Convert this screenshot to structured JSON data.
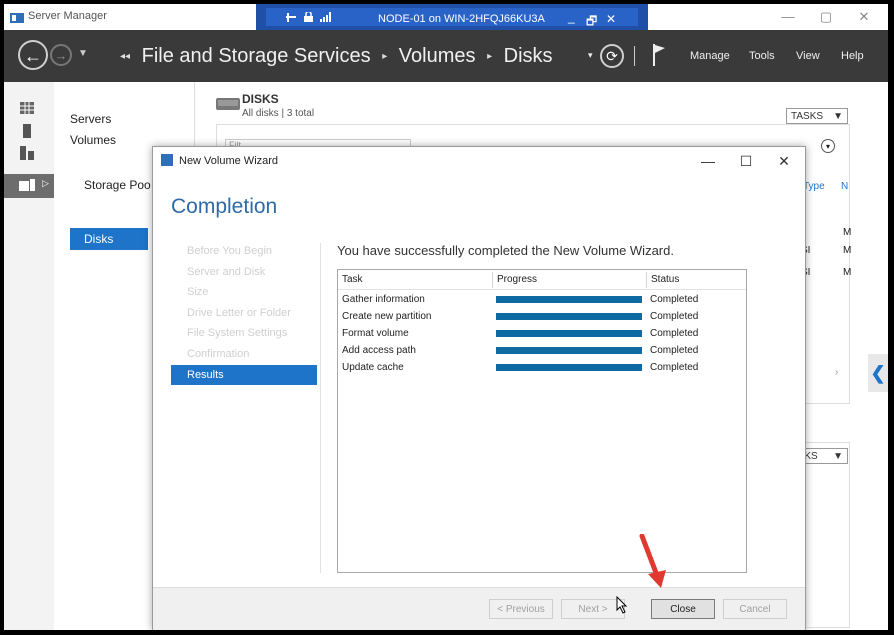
{
  "window": {
    "title": "Server Manager",
    "controls": {
      "minimize": "—",
      "maximize": "▢",
      "close": "✕"
    }
  },
  "remote": {
    "title": "NODE-01 on WIN-2HFQJ66KU3A",
    "icons": [
      "pin-icon",
      "lock-icon",
      "signal-icon"
    ],
    "controls": {
      "minimize": "_",
      "restore": "🗗",
      "close": "✕"
    }
  },
  "nav": {
    "back": "←",
    "forward": "→",
    "breadcrumb": [
      "File and Storage Services",
      "Volumes",
      "Disks"
    ],
    "refresh": "⟳",
    "menu": [
      "Manage",
      "Tools",
      "View",
      "Help"
    ]
  },
  "sidebar": {
    "items": [
      {
        "label": "Servers"
      },
      {
        "label": "Volumes"
      },
      {
        "label": "Disks"
      },
      {
        "label": "Storage Poo"
      }
    ]
  },
  "disks": {
    "title": "DISKS",
    "subtitle": "All disks | 3 total",
    "tasks_label": "TASKS",
    "tasks2_label": "ASKS",
    "filter_placeholder": "Filt",
    "column_type": "Type",
    "column_n": "N",
    "cells": [
      "M",
      "SI",
      "M",
      "SI",
      "M"
    ]
  },
  "wizard": {
    "title": "New Volume Wizard",
    "heading": "Completion",
    "steps": [
      "Before You Begin",
      "Server and Disk",
      "Size",
      "Drive Letter or Folder",
      "File System Settings",
      "Confirmation",
      "Results"
    ],
    "active_step": "Results",
    "message": "You have successfully completed the New Volume Wizard.",
    "columns": [
      "Task",
      "Progress",
      "Status"
    ],
    "tasks": [
      {
        "name": "Gather information",
        "progress": 1.0,
        "status": "Completed"
      },
      {
        "name": "Create new partition",
        "progress": 1.0,
        "status": "Completed"
      },
      {
        "name": "Format volume",
        "progress": 1.0,
        "status": "Completed"
      },
      {
        "name": "Add access path",
        "progress": 1.0,
        "status": "Completed"
      },
      {
        "name": "Update cache",
        "progress": 1.0,
        "status": "Completed"
      }
    ],
    "buttons": {
      "previous": "< Previous",
      "next": "Next >",
      "close": "Close",
      "cancel": "Cancel"
    }
  },
  "colors": {
    "accent": "#1d74c9",
    "progress": "#0e6aa3",
    "header": "#3a3a3a",
    "annotation": "#e03a30"
  }
}
